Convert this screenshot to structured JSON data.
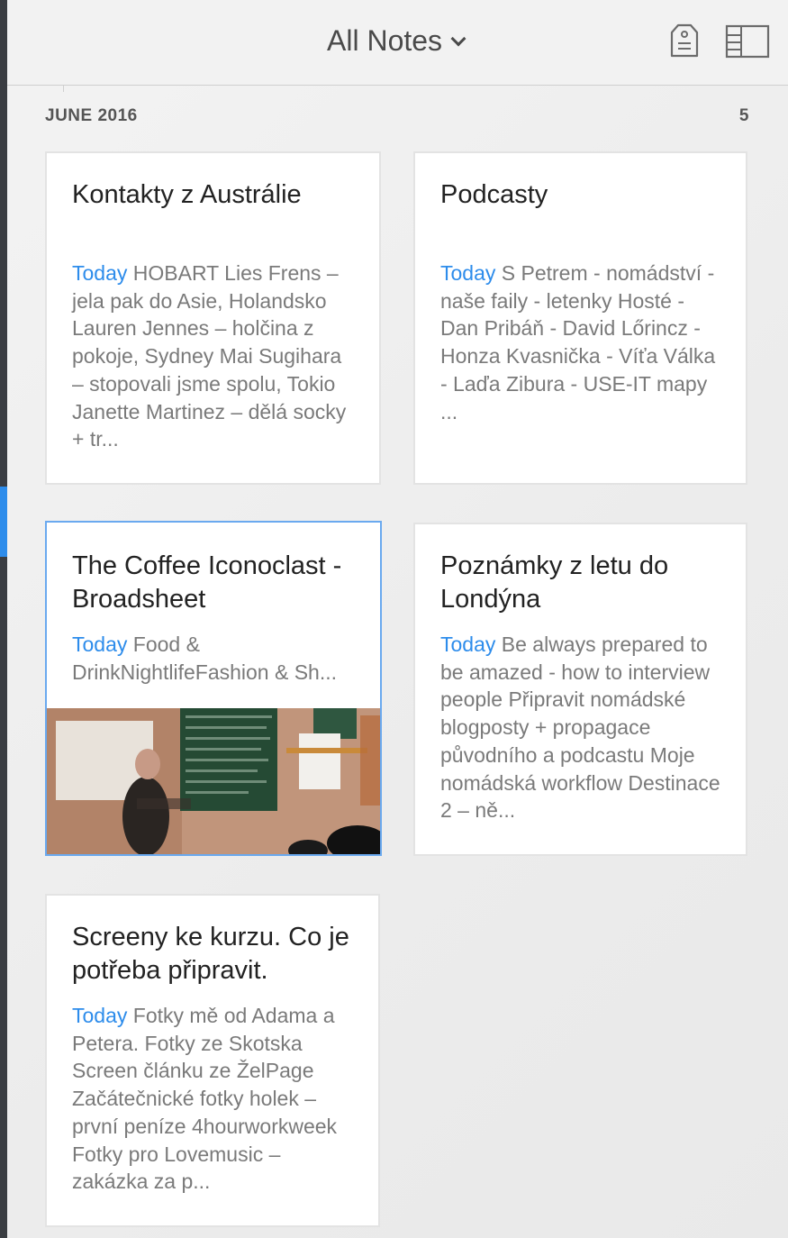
{
  "header": {
    "title": "All Notes"
  },
  "section": {
    "label": "JUNE 2016",
    "count": "5"
  },
  "notes": [
    {
      "title": "Kontakty z Austrálie",
      "date": "Today",
      "snippet": "HOBART Lies Frens – jela pak do Asie, Holandsko Lauren Jennes – holčina z pokoje, Sydney Mai Sugihara – stopovali jsme spolu, Tokio Janette Martinez – dělá socky + tr..."
    },
    {
      "title": "Podcasty",
      "date": "Today",
      "snippet": "S Petrem - nomádství - naše faily - letenky Hosté - Dan Pribáň - David Lőrincz - Honza Kvasnička - Víťa Válka - Laďa Zibura - USE-IT mapy ..."
    },
    {
      "title": "The Coffee Iconoclast - Broadsheet",
      "date": "Today",
      "snippet": "Food & DrinkNightlifeFashion & Sh..."
    },
    {
      "title": "Poznámky z letu do Londýna",
      "date": "Today",
      "snippet": "Be always prepared to be amazed - how to interview people Připravit nomádské blogposty + propagace původního a podcastu Moje nomádská workflow Destinace 2 – ně..."
    },
    {
      "title": "Screeny ke kurzu. Co je potřeba připravit.",
      "date": "Today",
      "snippet": "Fotky mě od Adama a Petera. Fotky ze Skotska Screen článku ze ŽelPage Začátečnické fotky holek – první peníze 4hourworkweek Fotky pro Lovemusic – zakázka za p..."
    }
  ],
  "colors": {
    "accent": "#2d8ceb",
    "selected_border": "#6aa9ef",
    "sidebar": "#3a3d42"
  },
  "icons": {
    "title_dropdown": "chevron-down-icon",
    "tag": "tag-icon",
    "layout": "layout-toggle-icon"
  }
}
